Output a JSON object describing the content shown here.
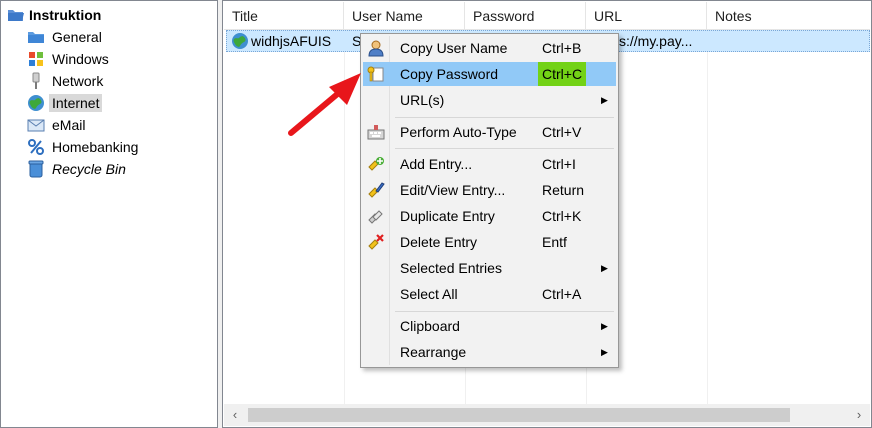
{
  "tree": {
    "root": "Instruktion",
    "items": [
      {
        "label": "General",
        "icon": "folder-icon",
        "italic": false,
        "selected": false
      },
      {
        "label": "Windows",
        "icon": "windows-icon",
        "italic": false,
        "selected": false
      },
      {
        "label": "Network",
        "icon": "network-icon",
        "italic": false,
        "selected": false
      },
      {
        "label": "Internet",
        "icon": "globe-icon",
        "italic": false,
        "selected": true
      },
      {
        "label": "eMail",
        "icon": "envelope-icon",
        "italic": false,
        "selected": false
      },
      {
        "label": "Homebanking",
        "icon": "percent-icon",
        "italic": false,
        "selected": false
      },
      {
        "label": "Recycle Bin",
        "icon": "recycle-bin-icon",
        "italic": true,
        "selected": false
      }
    ]
  },
  "list": {
    "columns": [
      "Title",
      "User Name",
      "Password",
      "URL",
      "Notes"
    ],
    "rows": [
      {
        "title": "widhjsAFUIS",
        "user": "S",
        "password": "",
        "url": "s://my.pay...",
        "notes": ""
      }
    ]
  },
  "menu": {
    "items": [
      {
        "label": "Copy User Name",
        "key": "Ctrl+B",
        "icon": "user-icon",
        "highlight": false,
        "submenu": false
      },
      {
        "label": "Copy Password",
        "key": "Ctrl+C",
        "icon": "key-icon",
        "highlight": true,
        "submenu": false
      },
      {
        "label": "URL(s)",
        "key": "",
        "icon": "",
        "highlight": false,
        "submenu": true
      },
      {
        "label": "Perform Auto-Type",
        "key": "Ctrl+V",
        "icon": "auto-type-icon",
        "highlight": false,
        "submenu": false
      },
      {
        "label": "Add Entry...",
        "key": "Ctrl+I",
        "icon": "add-entry-icon",
        "highlight": false,
        "submenu": false
      },
      {
        "label": "Edit/View Entry...",
        "key": "Return",
        "icon": "edit-entry-icon",
        "highlight": false,
        "submenu": false
      },
      {
        "label": "Duplicate Entry",
        "key": "Ctrl+K",
        "icon": "duplicate-entry-icon",
        "highlight": false,
        "submenu": false
      },
      {
        "label": "Delete Entry",
        "key": "Entf",
        "icon": "delete-entry-icon",
        "highlight": false,
        "submenu": false
      },
      {
        "label": "Selected Entries",
        "key": "",
        "icon": "",
        "highlight": false,
        "submenu": true
      },
      {
        "label": "Select All",
        "key": "Ctrl+A",
        "icon": "",
        "highlight": false,
        "submenu": false
      },
      {
        "label": "Clipboard",
        "key": "",
        "icon": "",
        "highlight": false,
        "submenu": true
      },
      {
        "label": "Rearrange",
        "key": "",
        "icon": "",
        "highlight": false,
        "submenu": true
      }
    ]
  },
  "colors": {
    "selection": "#cce8ff",
    "menu_highlight": "#91c9f7",
    "shortcut_highlight": "#73d216",
    "annotation_arrow": "#e8161b"
  }
}
